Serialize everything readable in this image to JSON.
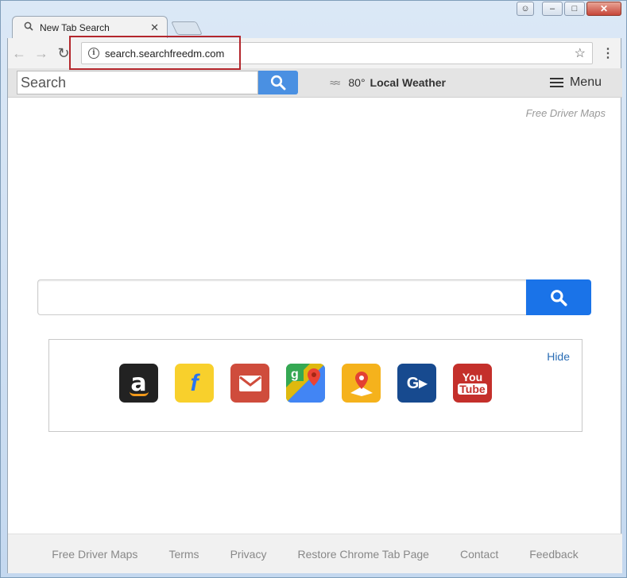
{
  "window": {
    "controls": {
      "user": "☺",
      "minimize": "–",
      "maximize": "□",
      "close": "✕"
    }
  },
  "tab": {
    "title": "New Tab Search",
    "icon": "search-icon",
    "close": "✕"
  },
  "toolbar": {
    "back": "←",
    "forward": "→",
    "reload": "↻",
    "url": "search.searchfreedm.com",
    "info": "i",
    "star": "☆",
    "menu": "⋮"
  },
  "topbar": {
    "search_placeholder": "Search",
    "weather_icon": "≈≈",
    "temperature": "80°",
    "weather_label": "Local Weather",
    "menu_label": "Menu"
  },
  "free_driver_maps_top": "Free Driver Maps",
  "main_search": {
    "placeholder": ""
  },
  "shortcuts": {
    "hide_label": "Hide",
    "items": [
      {
        "name": "amazon",
        "glyph": "a"
      },
      {
        "name": "flipkart",
        "glyph": "f"
      },
      {
        "name": "gmail"
      },
      {
        "name": "google-maps"
      },
      {
        "name": "maps-pin"
      },
      {
        "name": "gasbuddy",
        "glyph": "G▸"
      },
      {
        "name": "youtube",
        "you": "You",
        "tube": "Tube"
      }
    ]
  },
  "footer": {
    "links": [
      "Free Driver Maps",
      "Terms",
      "Privacy",
      "Restore Chrome Tab Page",
      "Contact",
      "Feedback"
    ]
  },
  "colors": {
    "accent": "#1a73e8",
    "highlight": "#b3262c",
    "link": "#2a6db5"
  }
}
